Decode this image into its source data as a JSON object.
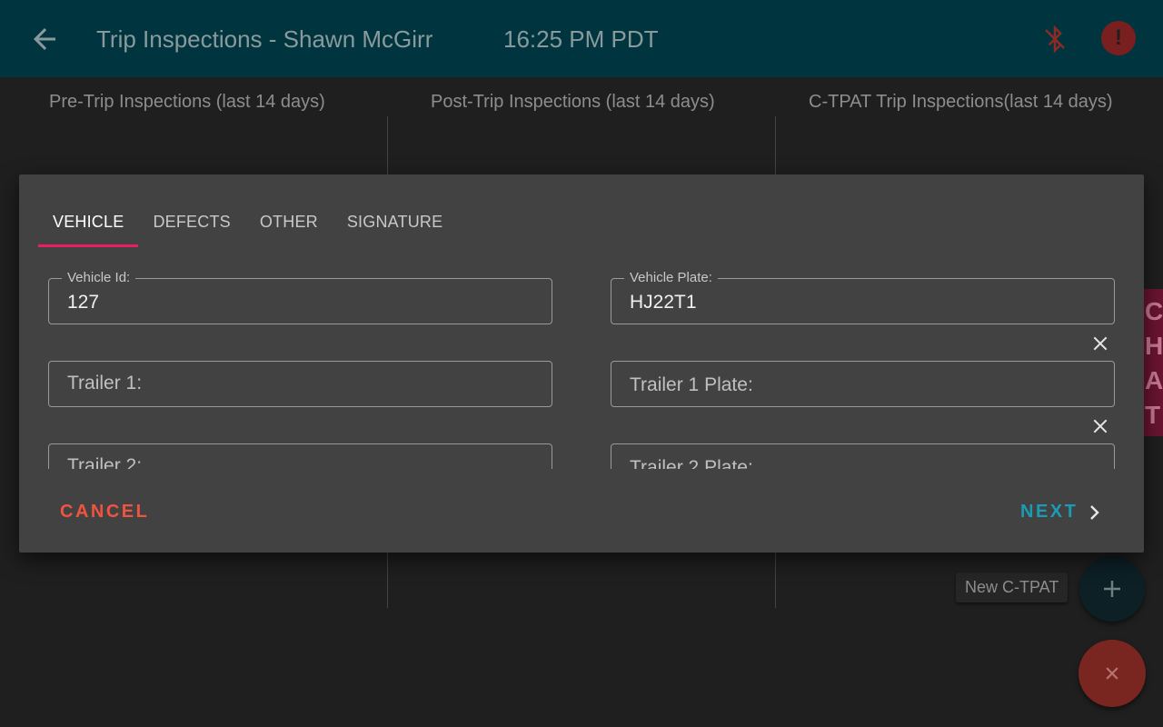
{
  "appbar": {
    "title": "Trip Inspections - Shawn McGirr",
    "time": "16:25 PM PDT",
    "background": "#00353f"
  },
  "columns": [
    {
      "header": "Pre-Trip Inspections (last 14 days)"
    },
    {
      "header": "Post-Trip Inspections (last 14 days)"
    },
    {
      "header": "C-TPAT Trip Inspections(last 14 days)"
    }
  ],
  "side_strip": {
    "letters": [
      "C",
      "H",
      "A",
      "T"
    ]
  },
  "fab": {
    "new_label": "New C-TPAT",
    "plus_glyph": "+",
    "close_glyph": "×"
  },
  "dialog": {
    "tabs": [
      {
        "label": "VEHICLE",
        "active": true
      },
      {
        "label": "DEFECTS",
        "active": false
      },
      {
        "label": "OTHER",
        "active": false
      },
      {
        "label": "SIGNATURE",
        "active": false
      }
    ],
    "fields": {
      "vehicle_id": {
        "label": "Vehicle Id:",
        "value": "127"
      },
      "vehicle_plate": {
        "label": "Vehicle Plate:",
        "value": "HJ22T1"
      },
      "trailer1": {
        "placeholder": "Trailer 1:"
      },
      "trailer1_plate": {
        "placeholder": "Trailer 1 Plate:"
      },
      "trailer2": {
        "placeholder": "Trailer 2:"
      },
      "trailer2_plate": {
        "placeholder": "Trailer 2 Plate:"
      }
    },
    "cancel_label": "CANCEL",
    "next_label": "NEXT"
  },
  "colors": {
    "accent_tab": "#e91e63",
    "cancel": "#f0533f",
    "next": "#1a9cb5",
    "dialog_bg": "#424242"
  }
}
